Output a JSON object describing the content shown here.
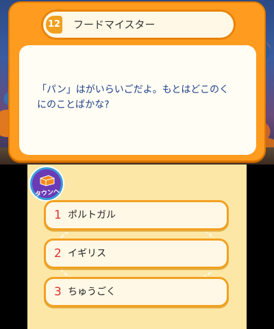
{
  "top": {
    "question_number": "12",
    "category": "フードマイスター",
    "question": "「パン」はがいらいごだよ。もとはどこのく\nにのことばかな?"
  },
  "bottom": {
    "town_button_label": "タウンへ",
    "answers": [
      {
        "number": "1",
        "text": "ポルトガル"
      },
      {
        "number": "2",
        "text": "イギリス"
      },
      {
        "number": "3",
        "text": "ちゅうごく"
      }
    ]
  },
  "colors": {
    "panel_orange": "#ff9b1f",
    "question_text": "#1f3f8a",
    "answer_number": "#e0302a",
    "bottom_bg": "#fde7a6"
  },
  "icons": {
    "town_button": "town-icon"
  }
}
